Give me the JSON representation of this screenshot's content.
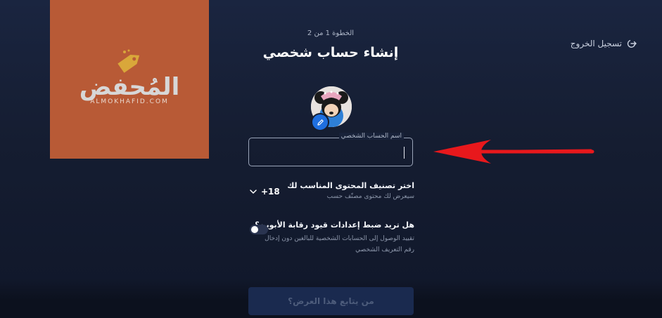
{
  "header": {
    "step_text": "الخطوة 1 من 2",
    "title": "إنشاء حساب شخصي",
    "logout_label": "تسجيل الخروج"
  },
  "watermark": {
    "brand_arabic": "المُحفض",
    "brand_latin": "ALMOKHAFID.COM",
    "color": "#b85a36"
  },
  "avatar": {
    "edit_icon": "pencil-icon"
  },
  "profile_name": {
    "label": "اسم الحساب الشخصي",
    "value": ""
  },
  "content_rating": {
    "title": "اختر تصنيف المحتوى المناسب لك",
    "subtitle": "سيعرض لك محتوى مصنّف حسب",
    "value": "+18",
    "icon": "chevron-down-icon"
  },
  "parental_pin": {
    "title": "هل تريد ضبط إعدادات قيود رقابة الأبوين؟",
    "description": "تقييد الوصول إلى الحسابات الشخصية للبالغين دون إدخال رقم التعريف الشخصي",
    "enabled": false
  },
  "footer": {
    "continue_label": "من يتابع هذا العرض؟"
  },
  "colors": {
    "background": "#151d31",
    "accent": "#1f6fe0",
    "annotation_arrow": "#e8181c"
  }
}
